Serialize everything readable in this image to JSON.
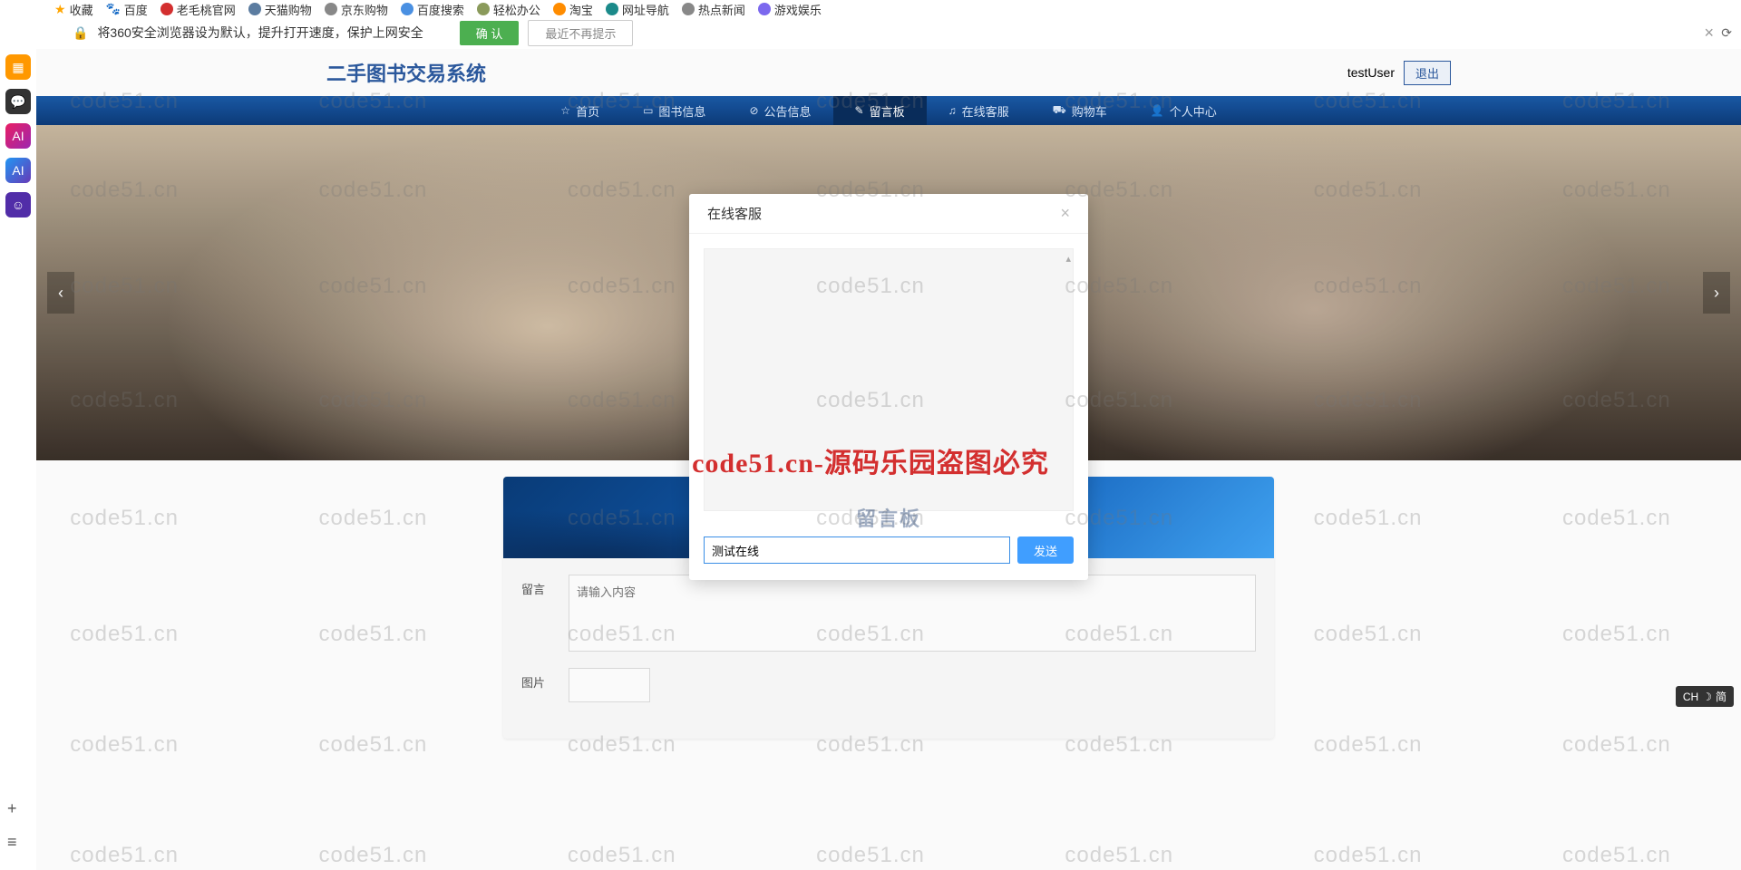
{
  "bookmarks": {
    "fav": "收藏",
    "items": [
      "百度",
      "老毛桃官网",
      "天猫购物",
      "京东购物",
      "百度搜索",
      "轻松办公",
      "淘宝",
      "网址导航",
      "热点新闻",
      "游戏娱乐"
    ]
  },
  "security": {
    "text": "将360安全浏览器设为默认，提升打开速度，保护上网安全",
    "confirm": "确 认",
    "noremind": "最近不再提示"
  },
  "site": {
    "title": "二手图书交易系统",
    "user": "testUser",
    "logout": "退出"
  },
  "nav": {
    "home": "首页",
    "books": "图书信息",
    "announce": "公告信息",
    "board": "留言板",
    "service": "在线客服",
    "cart": "购物车",
    "profile": "个人中心"
  },
  "board": {
    "title": "留言板",
    "msg_label": "留言",
    "msg_placeholder": "请输入内容",
    "img_label": "图片"
  },
  "modal": {
    "title": "在线客服",
    "input_value": "测试在线",
    "send": "发送"
  },
  "watermark": {
    "text": "code51.cn",
    "red": "code51.cn-源码乐园盗图必究"
  },
  "ime": {
    "label": "CH",
    "mode": "简"
  }
}
